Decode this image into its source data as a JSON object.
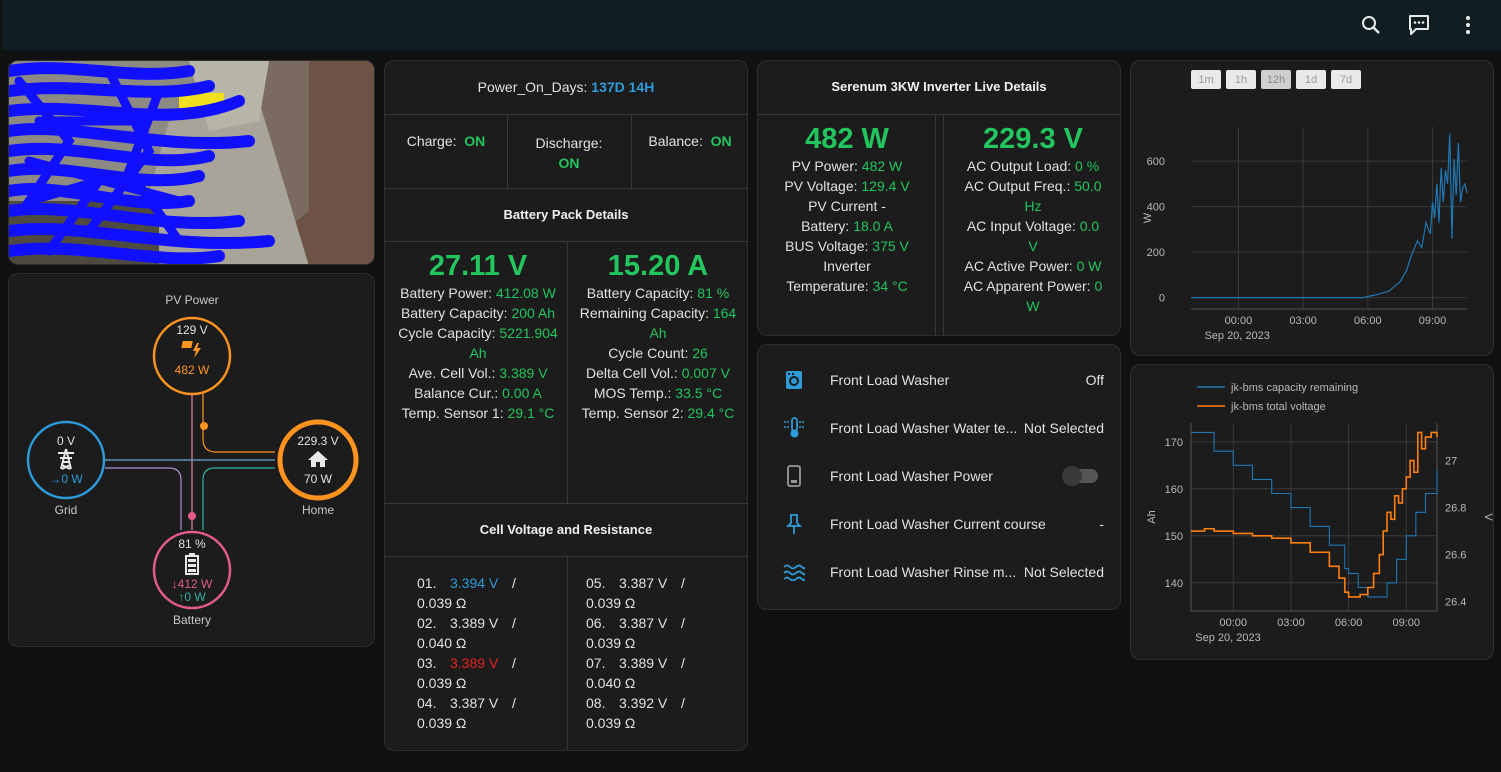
{
  "colors": {
    "topbar": "#101e24",
    "green": "#22c55e",
    "blue": "#2d9bd8",
    "orange": "#ff9320",
    "pink": "#e35b8d",
    "purple": "#9b59b6",
    "teal": "#2fb5a5",
    "red": "#e5231f"
  },
  "topbar": {
    "icons": [
      "search-icon",
      "assist-icon",
      "more-vertical-icon"
    ]
  },
  "energy_flow": {
    "pv_label": "PV Power",
    "pv_voltage": "129 V",
    "pv_power": "482 W",
    "grid_label": "Grid",
    "grid_voltage": "0 V",
    "grid_power": "→0 W",
    "home_label": "Home",
    "home_voltage": "229.3 V",
    "home_power": "70 W",
    "battery_label": "Battery",
    "battery_soc": "81 %",
    "battery_discharge": "↓412 W",
    "battery_charge": "↑0 W"
  },
  "bms": {
    "power_on_label": "Power_On_Days:",
    "power_on_value": "137D 14H",
    "charge_label": "Charge:",
    "charge_value": "ON",
    "discharge_label": "Discharge:",
    "discharge_value": "ON",
    "balance_label": "Balance:",
    "balance_value": "ON",
    "pack_title": "Battery Pack Details",
    "voltage": "27.11 V",
    "current": "15.20 A",
    "left_items": [
      {
        "label": "Battery Power:",
        "value": "412.08 W"
      },
      {
        "label": "Battery Capacity:",
        "value": "200 Ah"
      },
      {
        "label": "Cycle Capacity:",
        "value": "5221.904 Ah"
      },
      {
        "label": "Ave. Cell Vol.:",
        "value": "3.389 V"
      },
      {
        "label": "Balance Cur.:",
        "value": "0.00 A"
      },
      {
        "label": "Temp. Sensor 1:",
        "value": "29.1 °C"
      }
    ],
    "right_items": [
      {
        "label": "Battery Capacity:",
        "value": "81 %"
      },
      {
        "label": "Remaining Capacity:",
        "value": "164 Ah"
      },
      {
        "label": "Cycle Count:",
        "value": "26"
      },
      {
        "label": "Delta Cell Vol.:",
        "value": "0.007 V"
      },
      {
        "label": "MOS Temp.:",
        "value": "33.5 °C"
      },
      {
        "label": "Temp. Sensor 2:",
        "value": "29.4 °C"
      }
    ],
    "cell_title": "Cell Voltage and Resistance",
    "cells_left": [
      {
        "n": "01.",
        "v": "3.394 V",
        "r": "0.039 Ω",
        "color": "blue"
      },
      {
        "n": "02.",
        "v": "3.389 V",
        "r": "0.040 Ω",
        "color": ""
      },
      {
        "n": "03.",
        "v": "3.389 V",
        "r": "0.039 Ω",
        "color": "red"
      },
      {
        "n": "04.",
        "v": "3.387 V",
        "r": "0.039 Ω",
        "color": ""
      }
    ],
    "cells_right": [
      {
        "n": "05.",
        "v": "3.387 V",
        "r": "0.039 Ω",
        "color": ""
      },
      {
        "n": "06.",
        "v": "3.387 V",
        "r": "0.039 Ω",
        "color": ""
      },
      {
        "n": "07.",
        "v": "3.389 V",
        "r": "0.040 Ω",
        "color": ""
      },
      {
        "n": "08.",
        "v": "3.392 V",
        "r": "0.039 Ω",
        "color": ""
      }
    ],
    "slash": "/"
  },
  "inverter": {
    "title": "Serenum 3KW Inverter Live Details",
    "pv_power_big": "482 W",
    "ac_voltage_big": "229.3 V",
    "left_lines": [
      [
        {
          "t": "PV Power: ",
          "c": ""
        },
        {
          "t": "482 W",
          "c": "green"
        }
      ],
      [
        {
          "t": "PV Voltage: ",
          "c": ""
        },
        {
          "t": "129.4 V",
          "c": "green"
        }
      ],
      [
        {
          "t": "PV Current -",
          "c": ""
        }
      ],
      [
        {
          "t": "Battery: ",
          "c": ""
        },
        {
          "t": "18.0 A",
          "c": "green"
        }
      ],
      [
        {
          "t": "BUS Voltage: ",
          "c": ""
        },
        {
          "t": "375 V",
          "c": "green"
        }
      ],
      [
        {
          "t": "Inverter",
          "c": ""
        }
      ],
      [
        {
          "t": "Temperature: ",
          "c": ""
        },
        {
          "t": "34 °C",
          "c": "green"
        }
      ]
    ],
    "right_lines": [
      [
        {
          "t": "AC Output Load: ",
          "c": ""
        },
        {
          "t": "0 %",
          "c": "green"
        }
      ],
      [
        {
          "t": "AC Output Freq.: ",
          "c": ""
        },
        {
          "t": "50.0",
          "c": "green"
        }
      ],
      [
        {
          "t": "Hz",
          "c": "green"
        }
      ],
      [
        {
          "t": "AC Input Voltage: ",
          "c": ""
        },
        {
          "t": "0.0",
          "c": "green"
        }
      ],
      [
        {
          "t": "V",
          "c": "green"
        }
      ],
      [
        {
          "t": "AC Active Power: ",
          "c": ""
        },
        {
          "t": "0 W",
          "c": "green"
        }
      ],
      [
        {
          "t": "AC Apparent Power: ",
          "c": ""
        },
        {
          "t": "0",
          "c": "green"
        }
      ],
      [
        {
          "t": "W",
          "c": "green"
        }
      ]
    ]
  },
  "washer": {
    "rows": [
      {
        "icon": "washing-machine-icon",
        "name": "Front Load Washer",
        "state": "Off"
      },
      {
        "icon": "thermometer-water-icon",
        "name": "Front Load Washer Water te...",
        "state": "Not Selected"
      },
      {
        "icon": "power-plug-icon",
        "name": "Front Load Washer Power",
        "state": ""
      },
      {
        "icon": "pin-icon",
        "name": "Front Load Washer Current course",
        "state": "-"
      },
      {
        "icon": "water-waves-icon",
        "name": "Front Load Washer Rinse m...",
        "state": "Not Selected"
      }
    ],
    "power_toggle": false
  },
  "chart_data": [
    {
      "type": "line",
      "range_buttons": [
        "1m",
        "1h",
        "12h",
        "1d",
        "7d"
      ],
      "active_range": "12h",
      "ylabel": "W",
      "yticks": [
        "0",
        "200",
        "400",
        "600"
      ],
      "ylim": [
        -50,
        750
      ],
      "xticks": [
        "00:00",
        "03:00",
        "06:00",
        "09:00"
      ],
      "date_label": "Sep 20, 2023",
      "xlim": [
        -2.2,
        10.6
      ],
      "series": [
        {
          "color": "#1f77b4",
          "x": [
            -2.2,
            5.8,
            6.0,
            6.5,
            7.0,
            7.5,
            7.8,
            8.0,
            8.3,
            8.5,
            8.7,
            8.9,
            9.0,
            9.1,
            9.2,
            9.3,
            9.4,
            9.5,
            9.6,
            9.7,
            9.8,
            9.9,
            10.0,
            10.1,
            10.2,
            10.3,
            10.4,
            10.5,
            10.6
          ],
          "y": [
            0,
            0,
            5,
            15,
            30,
            70,
            120,
            180,
            250,
            220,
            330,
            280,
            420,
            350,
            500,
            330,
            570,
            420,
            560,
            500,
            720,
            260,
            610,
            450,
            680,
            420,
            480,
            500,
            460
          ]
        }
      ]
    },
    {
      "type": "line",
      "legend": [
        "jk-bms capacity remaining",
        "jk-bms total voltage"
      ],
      "ylabel_left": "Ah",
      "ylabel_right": "V",
      "yticks_left": [
        "140",
        "150",
        "160",
        "170"
      ],
      "ylim_left": [
        134,
        174
      ],
      "yticks_right": [
        "26.4",
        "26.6",
        "26.8",
        "27"
      ],
      "ylim_right": [
        26.36,
        27.16
      ],
      "xticks": [
        "00:00",
        "03:00",
        "06:00",
        "09:00"
      ],
      "date_label": "Sep 20, 2023",
      "xlim": [
        -2.2,
        10.6
      ],
      "series": [
        {
          "name": "jk-bms capacity remaining",
          "axis": "left",
          "color": "#1f77b4",
          "x": [
            -2.2,
            -1.0,
            0.0,
            1.0,
            2.0,
            3.0,
            4.0,
            5.0,
            5.8,
            6.0,
            6.5,
            7.0,
            7.5,
            8.0,
            8.5,
            9.0,
            9.5,
            10.0,
            10.6
          ],
          "y": [
            172,
            168,
            165,
            162,
            159,
            156,
            152,
            148,
            143,
            142,
            139,
            137,
            137,
            140,
            145,
            150,
            155,
            159,
            164
          ]
        },
        {
          "name": "jk-bms total voltage",
          "axis": "right",
          "color": "#ff7f0e",
          "x": [
            -2.2,
            -1.5,
            -1.0,
            0.0,
            1.0,
            2.0,
            3.0,
            4.0,
            5.0,
            5.5,
            5.8,
            6.0,
            6.3,
            6.6,
            7.0,
            7.3,
            7.6,
            7.8,
            8.0,
            8.2,
            8.4,
            8.6,
            8.8,
            9.0,
            9.2,
            9.4,
            9.6,
            9.8,
            10.0,
            10.3,
            10.6
          ],
          "y": [
            26.7,
            26.71,
            26.7,
            26.69,
            26.68,
            26.67,
            26.65,
            26.61,
            26.55,
            26.5,
            26.44,
            26.42,
            26.42,
            26.43,
            26.46,
            26.52,
            26.6,
            26.7,
            26.78,
            26.75,
            26.85,
            26.82,
            26.88,
            26.93,
            27.0,
            26.95,
            27.12,
            27.05,
            27.1,
            27.12,
            27.1
          ]
        }
      ]
    }
  ]
}
